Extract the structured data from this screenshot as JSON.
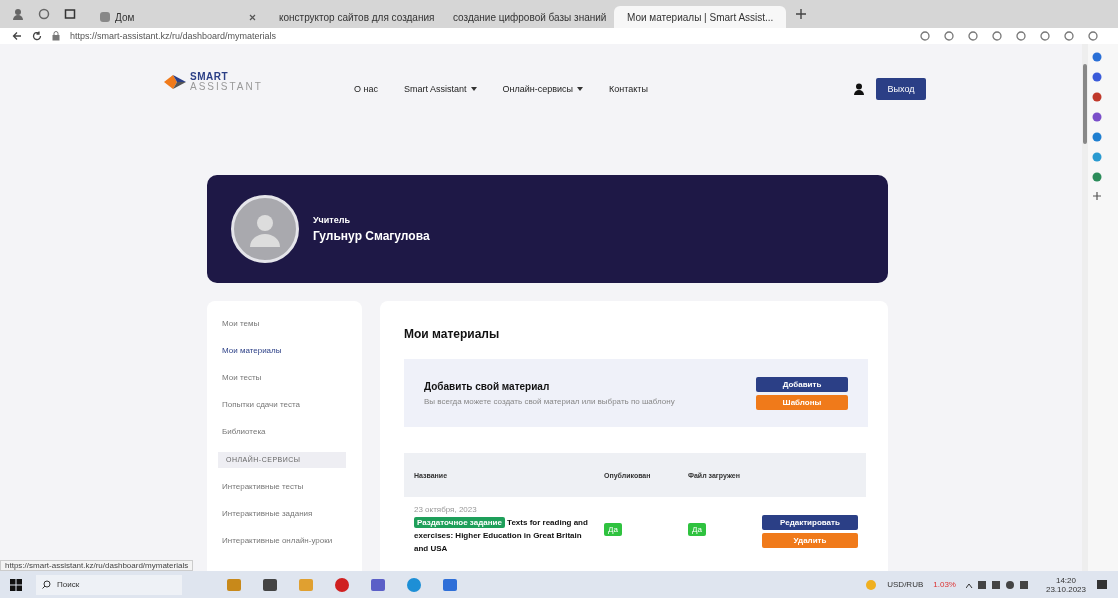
{
  "browser": {
    "tabs": [
      {
        "title": "Дом",
        "selected": false
      },
      {
        "title": "конструктор сайтов для создания",
        "selected": false
      },
      {
        "title": "создание цифровой базы знаний",
        "selected": false
      },
      {
        "title": "Мои материалы | Smart Assist...",
        "selected": true
      }
    ],
    "address": "https://smart-assistant.kz/ru/dashboard/mymaterials"
  },
  "header": {
    "logo_top": "SMART",
    "logo_bottom": "ASSISTANT",
    "nav": [
      {
        "label": "О нас",
        "dropdown": false
      },
      {
        "label": "Smart Assistant",
        "dropdown": true
      },
      {
        "label": "Онлайн-сервисы",
        "dropdown": true
      },
      {
        "label": "Контакты",
        "dropdown": false
      }
    ],
    "logout": "Выход"
  },
  "profile": {
    "role": "Учитель",
    "name": "Гульнур Смагулова"
  },
  "sidebar": {
    "items": [
      {
        "kind": "link",
        "label": "Мои темы",
        "selected": false
      },
      {
        "kind": "link",
        "label": "Мои материалы",
        "selected": true
      },
      {
        "kind": "link",
        "label": "Мои тесты",
        "selected": false
      },
      {
        "kind": "link",
        "label": "Попытки сдачи теста",
        "selected": false
      },
      {
        "kind": "link",
        "label": "Библиотека",
        "selected": false
      },
      {
        "kind": "heading",
        "label": "ОНЛАЙН-СЕРВИСЫ"
      },
      {
        "kind": "link",
        "label": "Интерактивные тесты",
        "selected": false
      },
      {
        "kind": "link",
        "label": "Интерактивные задания",
        "selected": false
      },
      {
        "kind": "link",
        "label": "Интерактивные онлайн-уроки",
        "selected": false
      }
    ]
  },
  "content": {
    "title": "Мои материалы",
    "add_box": {
      "title": "Добавить свой материал",
      "text": "Вы всегда можете создать свой материал или выбрать по шаблону",
      "buttons": [
        "Добавить",
        "Шаблоны"
      ]
    },
    "table": {
      "columns": [
        "Название",
        "Опубликован",
        "Файл загружен"
      ],
      "rows": [
        {
          "date": "23 октября, 2023",
          "tag": "Раздаточное задание",
          "title": "Texts for reading and exercises: Higher Education in Great Britain and USA",
          "published": "Да",
          "uploaded": "Да",
          "actions": [
            "Редактировать",
            "Удалить"
          ]
        }
      ]
    }
  },
  "status_url": "https://smart-assistant.kz/ru/dashboard/mymaterials",
  "taskbar": {
    "search": "Поиск",
    "ticker": "USD/RUB",
    "change": "1.03%",
    "time": "14:20",
    "date": "23.10.2023"
  }
}
